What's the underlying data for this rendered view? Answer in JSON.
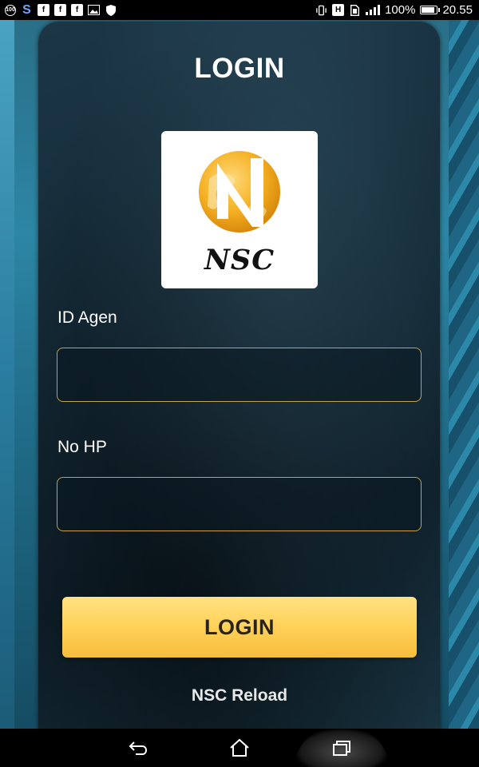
{
  "status_bar": {
    "left_icons": [
      "notification-100-icon",
      "s-app-icon",
      "facebook-icon",
      "facebook-icon",
      "facebook-icon",
      "image-icon",
      "shield-icon"
    ],
    "battery_percent": "100%",
    "battery_level": 1.0,
    "time": "20.55",
    "h_label": "H"
  },
  "login": {
    "title": "LOGIN",
    "logo_text": "NSC",
    "id_label": "ID Agen",
    "id_value": "",
    "hp_label": "No HP",
    "hp_value": "",
    "button_label": "LOGIN",
    "footer": "NSC Reload"
  },
  "colors": {
    "accent_gold": "#f7c24a",
    "input_border": "#c6a04a",
    "card_bg": "#142a37",
    "text": "#ffffff"
  },
  "nav_bar": {
    "items": [
      "back-icon",
      "home-icon",
      "recent-apps-icon"
    ]
  }
}
